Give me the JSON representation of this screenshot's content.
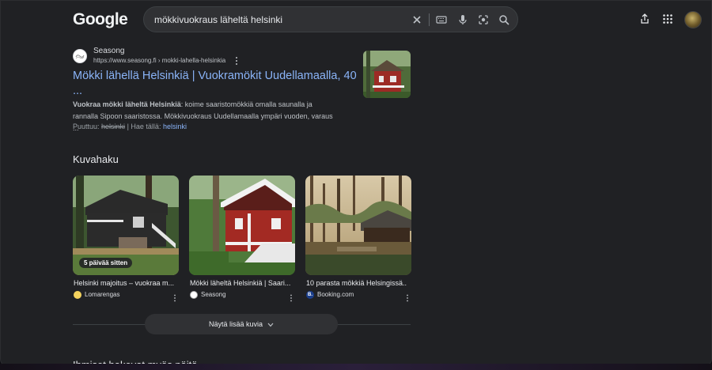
{
  "header": {
    "logo": "Google",
    "query": "mökkivuokraus läheltä helsinki"
  },
  "result": {
    "site_name": "Seasong",
    "site_url": "https://www.seasong.fi › mokki-lahella-helsinkia",
    "title": "Mökki lähellä Helsinkiä | Vuokramökit Uudellamaalla, 40 ...",
    "snippet_bold": "Vuokraa mökki läheltä Helsinkiä",
    "snippet_rest": ": koime saaristomökkiä omalla saunalla ja rannalla Sipoon saaristossa. Mökkivuokraus Uudellamaalla ympäri vuoden, varaus ...",
    "missing_label": "Puuttuu:",
    "missing_term": "helsinki",
    "must_include_label": "| Hae tällä:",
    "must_include_term": "helsinki"
  },
  "images": {
    "section_title": "Kuvahaku",
    "cards": [
      {
        "caption": "Helsinki majoitus – vuokraa m...",
        "source": "Lomarengas",
        "badge": "5 päivää sitten",
        "source_color": "#f4d35e"
      },
      {
        "caption": "Mökki läheltä Helsinkiä | Saari...",
        "source": "Seasong",
        "source_color": "#ffffff"
      },
      {
        "caption": "10 parasta mökkiä Helsingissä...",
        "source": "Booking.com",
        "source_color": "#1a3e8c",
        "source_letter": "B."
      }
    ],
    "more_button": "Näytä lisää kuvia"
  },
  "people_also_ask": "Ihmiset hakevat myös näitä"
}
